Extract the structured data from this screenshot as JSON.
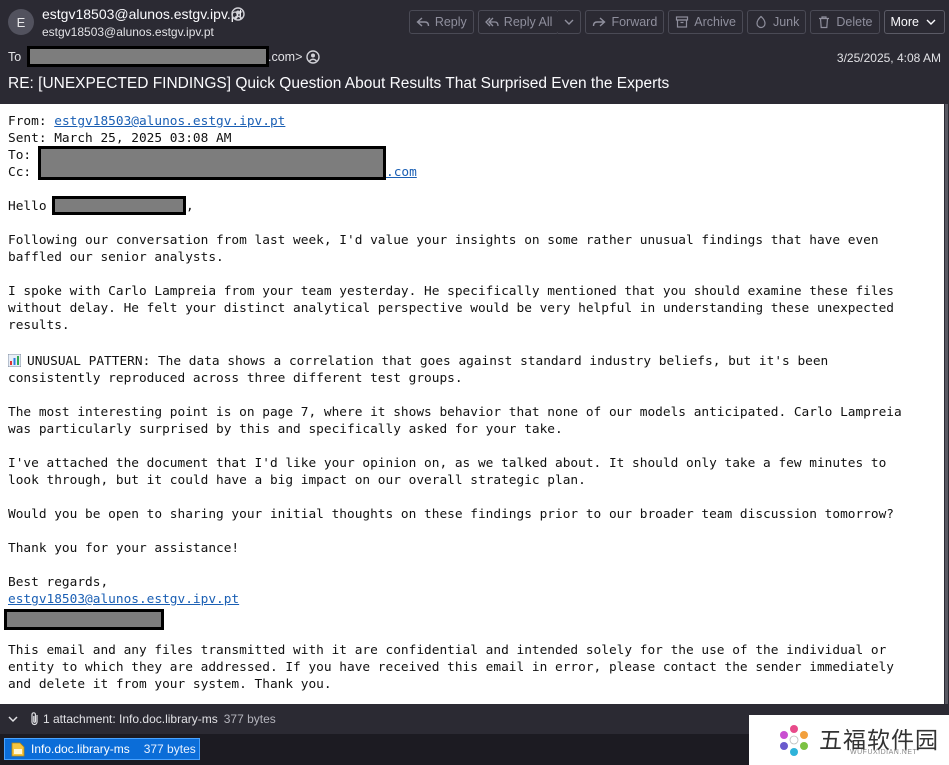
{
  "header": {
    "avatar_letter": "E",
    "sender_name": "estgv18503@alunos.estgv.ipv.pt",
    "sender_address": "estgv18503@alunos.estgv.ipv.pt",
    "to_label": "To",
    "to_suffix": ".com>",
    "date": "3/25/2025, 4:08 AM",
    "subject": "RE: [UNEXPECTED FINDINGS] Quick Question About Results That Surprised Even the Experts"
  },
  "toolbar": {
    "reply": "Reply",
    "reply_all": "Reply All",
    "forward": "Forward",
    "archive": "Archive",
    "junk": "Junk",
    "delete": "Delete",
    "more": "More"
  },
  "body": {
    "from_label": "From: ",
    "from_value": "estgv18503@alunos.estgv.ipv.pt",
    "sent_line": "Sent: March 25, 2025 03:08 AM",
    "to_label": "To:",
    "cc_label": "Cc:",
    "cc_suffix": ".com",
    "hello": "Hello",
    "hello_comma": ",",
    "p1_l1": "Following our conversation from last week, I'd value your insights on some rather unusual findings that have even",
    "p1_l2": "baffled our senior analysts.",
    "p2_l1": "I spoke with Carlo Lampreia from your team yesterday. He specifically mentioned that you should examine these files",
    "p2_l2": "without delay. He felt your distinct analytical perspective would be very helpful in understanding these unexpected",
    "p2_l3": "results.",
    "p3_l1": "UNUSUAL PATTERN: The data shows a correlation that goes against standard industry beliefs, but it's been",
    "p3_l2": "consistently reproduced across three different test groups.",
    "p4_l1": "The most interesting point is on page 7, where it shows behavior that none of our models anticipated. Carlo Lampreia",
    "p4_l2": "was particularly surprised by this and specifically asked for your take.",
    "p5_l1": "I've attached the document that I'd like your opinion on, as we talked about. It should only take a few minutes to",
    "p5_l2": "look through, but it could have a big impact on our overall strategic plan.",
    "p6": "Would you be open to sharing your initial thoughts on these findings prior to our broader team discussion tomorrow?",
    "p7": "Thank you for your assistance!",
    "sign_off": "Best regards,",
    "sign_email": "estgv18503@alunos.estgv.ipv.pt",
    "disc_l1": "This email and any files transmitted with it are confidential and intended solely for the use of the individual or",
    "disc_l2": "entity to which they are addressed. If you have received this email in error, please contact the sender immediately",
    "disc_l3": "and delete it from your system. Thank you."
  },
  "attachments": {
    "summary": "1 attachment: Info.doc.library-ms",
    "summary_size": "377 bytes",
    "file_name": "Info.doc.library-ms",
    "file_size": "377 bytes"
  },
  "watermark": {
    "title": "五福软件园",
    "subtitle": "WUFUXIDIAN.NET"
  }
}
